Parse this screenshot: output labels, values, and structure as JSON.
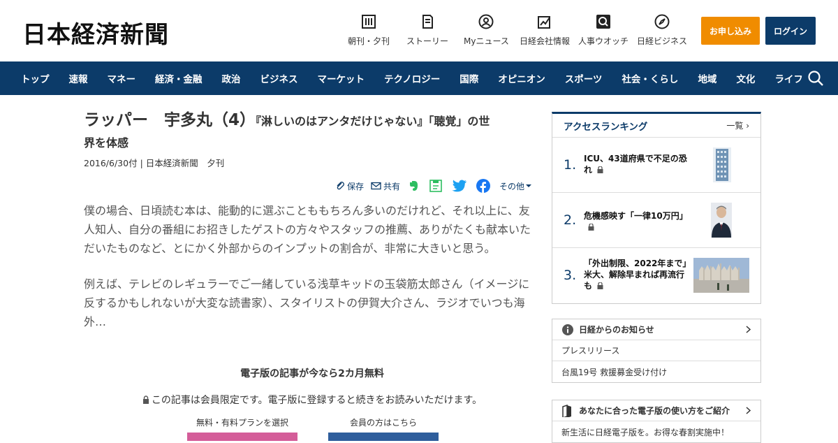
{
  "header": {
    "logo": "日本経済新聞",
    "nav": [
      {
        "label": "朝刊・夕刊",
        "icon": "newspaper-icon"
      },
      {
        "label": "ストーリー",
        "icon": "story-icon"
      },
      {
        "label": "Myニュース",
        "icon": "my-news-icon"
      },
      {
        "label": "日経会社情報",
        "icon": "company-info-icon"
      },
      {
        "label": "人事ウオッチ",
        "icon": "personnel-watch-icon"
      },
      {
        "label": "日経ビジネス",
        "icon": "nikkei-business-icon"
      }
    ],
    "apply_label": "お申し込み",
    "login_label": "ログイン"
  },
  "navbar": {
    "items": [
      "トップ",
      "速報",
      "マネー",
      "経済・金融",
      "政治",
      "ビジネス",
      "マーケット",
      "テクノロジー",
      "国際",
      "オピニオン",
      "スポーツ",
      "社会・くらし",
      "地域",
      "文化",
      "ライフ"
    ]
  },
  "article": {
    "title_main": "ラッパー　宇多丸（4）",
    "title_sub1": "『淋しいのはアンタだけじゃない』「聴覚」の世",
    "title_sub2": "界を体感",
    "meta": "2016/6/30付 | 日本経済新聞　夕刊",
    "share": {
      "save": "保存",
      "share": "共有",
      "other": "その他"
    },
    "paragraphs": [
      "僕の場合、日頃読む本は、能動的に選ぶことももちろん多いのだけれど、それ以上に、友人知人、自分の番組にお招きしたゲストの方々やスタッフの推薦、ありがたくも献本いただいたものなど、とにかく外部からのインプットの割合が、非常に大きいと思う。",
      "例えば、テレビのレギュラーでご一緒している浅草キッドの玉袋筋太郎さん（イメージに反するかもしれないが大変な読書家）、スタイリストの伊賀大介さん、ラジオでいつも海外…"
    ],
    "promo_title": "電子版の記事が今なら2カ月無料",
    "promo_note": "この記事は会員限定です。電子版に登録すると続きをお読みいただけます。",
    "plan_free": "無料・有料プランを選択",
    "plan_member": "会員の方はこちら"
  },
  "sidebar": {
    "ranking": {
      "title": "アクセスランキング",
      "all": "一覧",
      "items": [
        {
          "num": "1.",
          "text": "ICU、43道府県で不足の恐れ"
        },
        {
          "num": "2.",
          "text": "危機感映す「一律10万円」"
        },
        {
          "num": "3.",
          "text": "「外出制限、2022年まで」　米大、解除早まれば再流行も"
        }
      ]
    },
    "notice": {
      "title": "日経からのお知らせ",
      "items": [
        "プレスリリース",
        "台風19号 救援募金受け付け"
      ]
    },
    "guide": {
      "title": "あなたに合った電子版の使い方をご紹介",
      "items": [
        "新生活に日経電子版を。お得な春割実施中！"
      ]
    }
  },
  "colors": {
    "navy": "#0c3b69",
    "orange": "#f08c00",
    "pink": "#d45d99",
    "blue": "#2f5e9c"
  }
}
